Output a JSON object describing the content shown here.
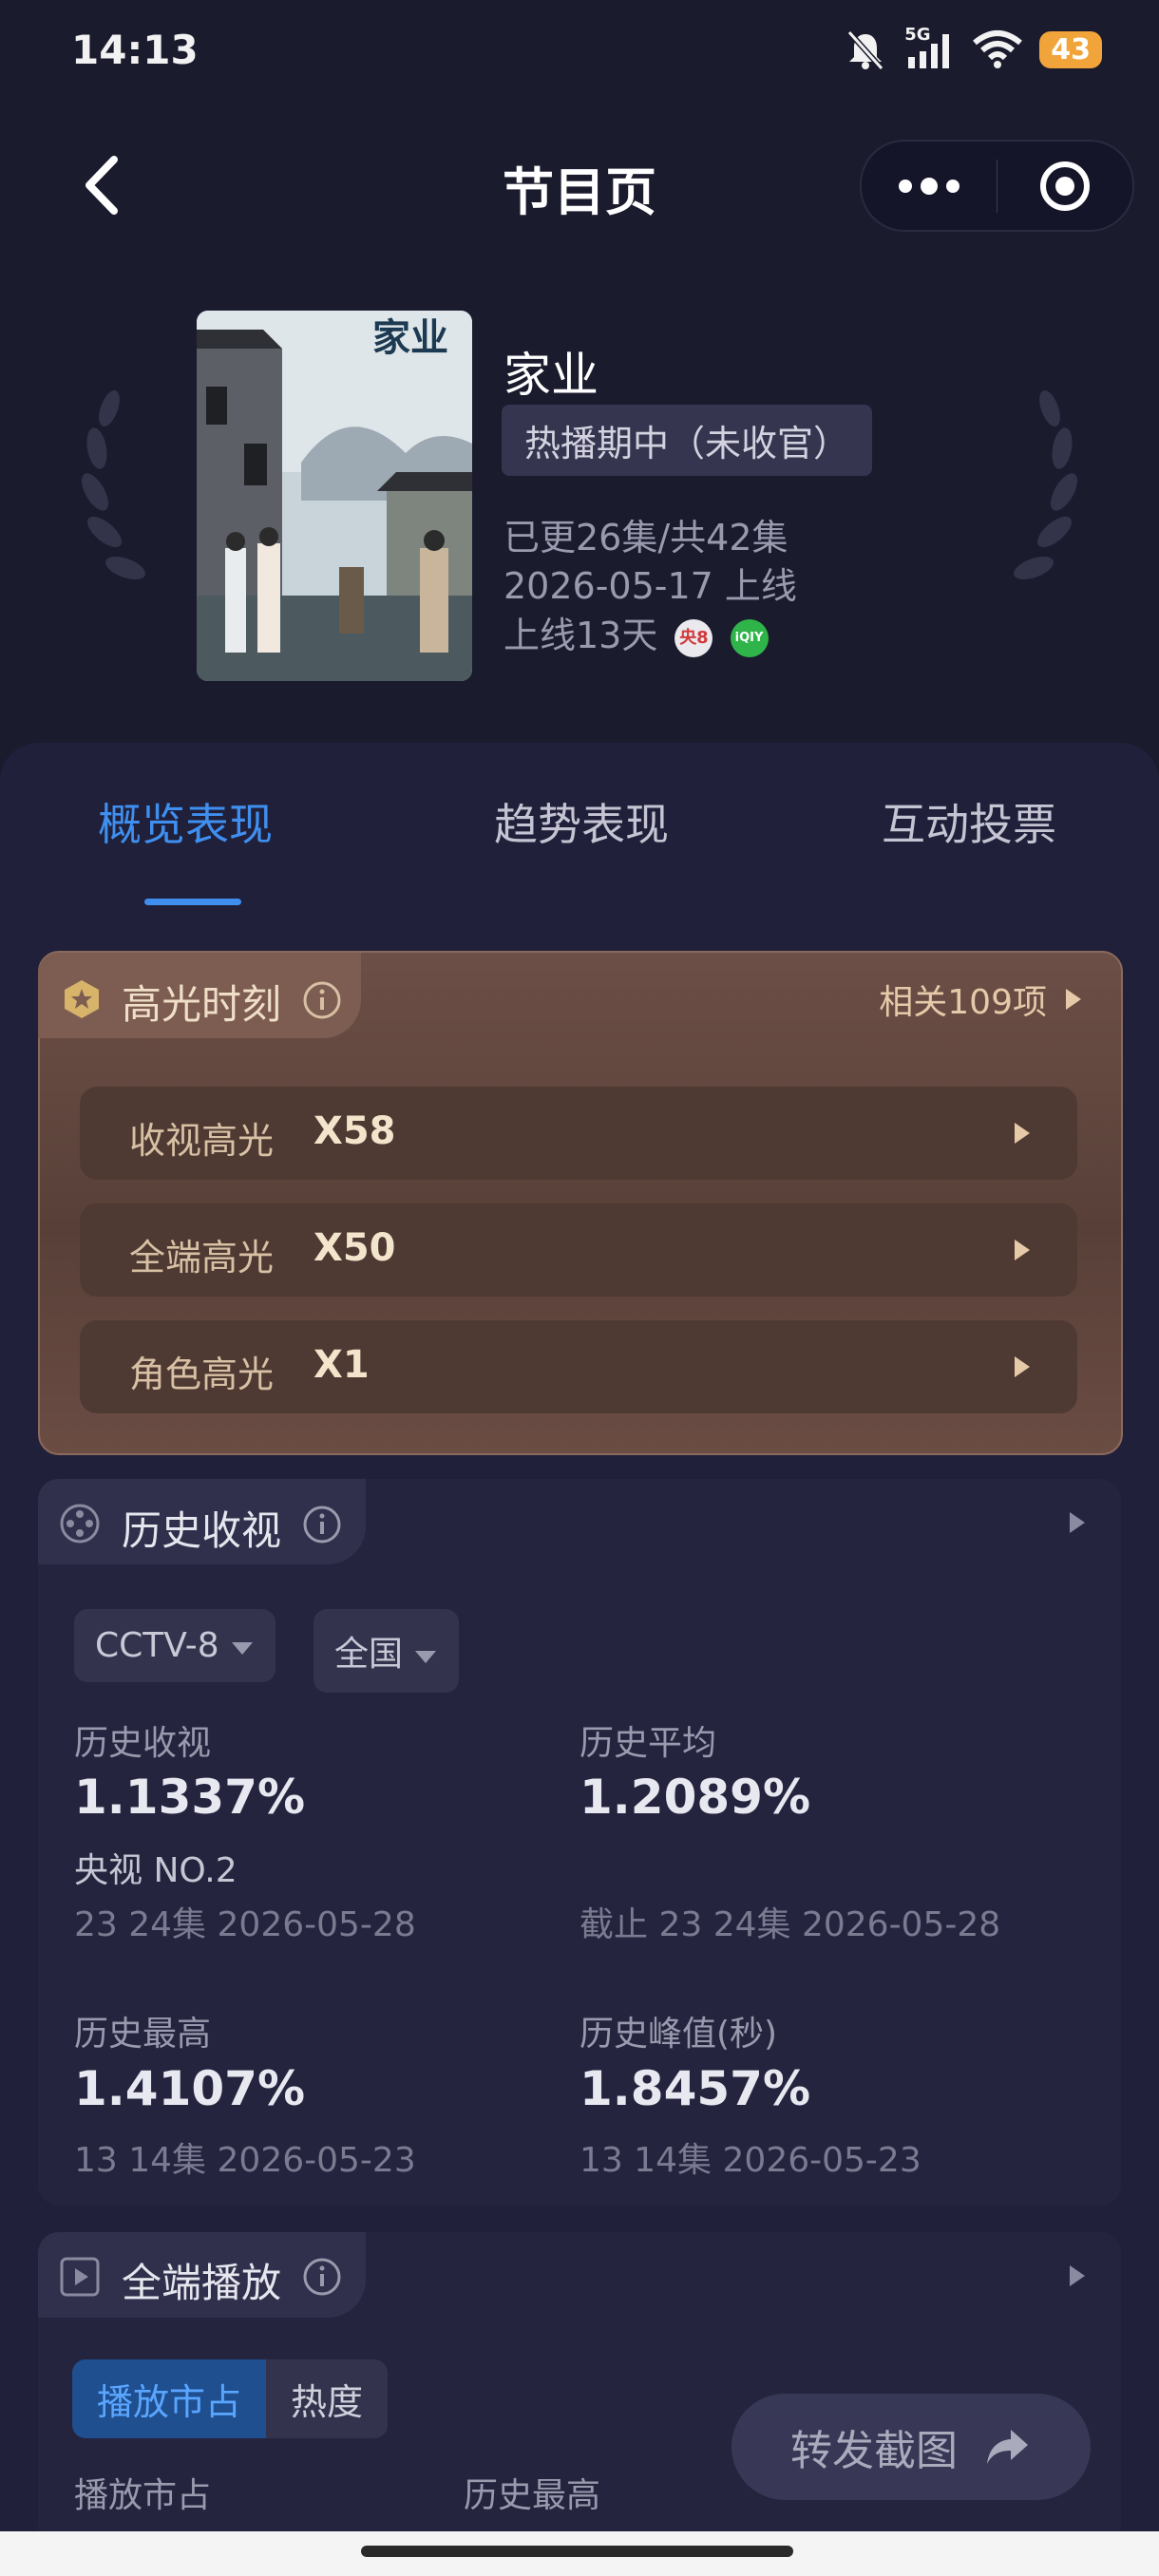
{
  "status_bar": {
    "time": "14:13",
    "network": "5G",
    "battery": "43"
  },
  "nav": {
    "title": "节目页"
  },
  "show": {
    "title": "家业",
    "poster_text": "家业",
    "status": "热播期中（未收官）",
    "episodes": "已更26集/共42集",
    "premiere": "2026-05-17 上线",
    "days_online": "上线13天",
    "channel_badge_1": "央8",
    "channel_badge_2": "iQIY"
  },
  "tabs": [
    {
      "label": "概览表现",
      "active": true
    },
    {
      "label": "趋势表现",
      "active": false
    },
    {
      "label": "互动投票",
      "active": false
    }
  ],
  "highlights": {
    "title": "高光时刻",
    "related": "相关109项",
    "rows": [
      {
        "label": "收视高光",
        "value": "X58"
      },
      {
        "label": "全端高光",
        "value": "X50"
      },
      {
        "label": "角色高光",
        "value": "X1"
      }
    ]
  },
  "history_ratings": {
    "title": "历史收视",
    "channel": "CCTV-8",
    "region": "全国",
    "stats": {
      "history": {
        "label": "历史收视",
        "value": "1.1337%",
        "rank": "央视 NO.2",
        "detail": "23 24集 2026-05-28"
      },
      "average": {
        "label": "历史平均",
        "value": "1.2089%",
        "detail": "截止 23 24集 2026-05-28"
      },
      "highest": {
        "label": "历史最高",
        "value": "1.4107%",
        "detail": "13 14集 2026-05-23"
      },
      "peak": {
        "label": "历史峰值(秒)",
        "value": "1.8457%",
        "detail": "13 14集 2026-05-23"
      }
    }
  },
  "all_platform": {
    "title": "全端播放",
    "segment_on": "播放市占",
    "segment_off": "热度",
    "col1": "播放市占",
    "col2": "历史最高"
  },
  "share_button": "转发截图",
  "colors": {
    "accent": "#3f8ff0",
    "background": "#1b1b2e",
    "highlight_card": "#6c4f46"
  }
}
